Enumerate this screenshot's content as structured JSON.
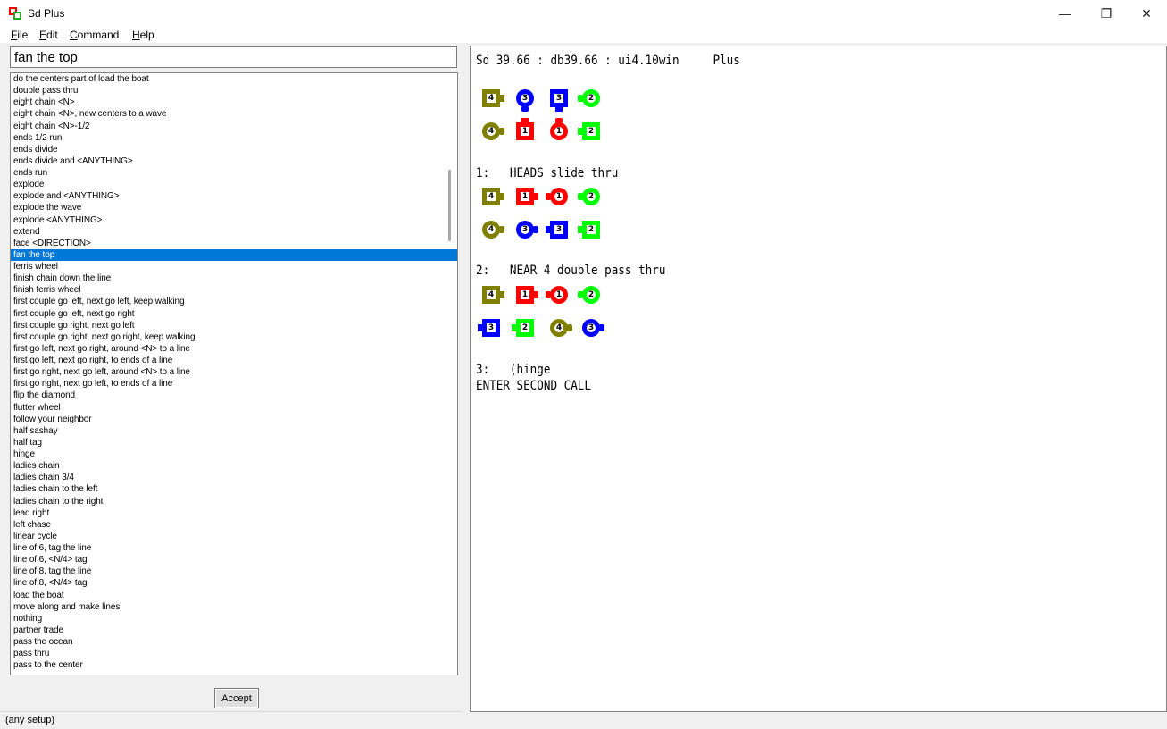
{
  "window": {
    "title": "Sd Plus",
    "minimize": "—",
    "maximize": "❐",
    "close": "✕"
  },
  "menu": [
    {
      "u": "F",
      "rest": "ile"
    },
    {
      "u": "E",
      "rest": "dit"
    },
    {
      "u": "C",
      "rest": "ommand"
    },
    {
      "u": "H",
      "rest": "elp"
    }
  ],
  "command_input": {
    "value": "fan the top"
  },
  "calls": [
    "do the centers part of load the boat",
    "double pass thru",
    "eight chain <N>",
    "eight chain <N>, new centers to a wave",
    "eight chain <N>-1/2",
    "ends 1/2 run",
    "ends divide",
    "ends divide and <ANYTHING>",
    "ends run",
    "explode",
    "explode and <ANYTHING>",
    "explode the wave",
    "explode <ANYTHING>",
    "extend",
    "face <DIRECTION>",
    "fan the top",
    "ferris wheel",
    "finish chain down the line",
    "finish ferris wheel",
    "first couple go left, next go left, keep walking",
    "first couple go left, next go right",
    "first couple go right, next go left",
    "first couple go right, next go right, keep walking",
    "first go left, next go right, around <N> to a line",
    "first go left, next go right, to ends of a line",
    "first go right, next go left, around <N> to a line",
    "first go right, next go left, to ends of a line",
    "flip the diamond",
    "flutter wheel",
    "follow your neighbor",
    "half sashay",
    "half tag",
    "hinge",
    "ladies chain",
    "ladies chain 3/4",
    "ladies chain to the left",
    "ladies chain to the right",
    "lead right",
    "left chase",
    "linear cycle",
    "line of 6, tag the line",
    "line of 6, <N/4> tag",
    "line of 8, tag the line",
    "line of 8, <N/4> tag",
    "load the boat",
    "move along and make lines",
    "nothing",
    "partner trade",
    "pass the ocean",
    "pass thru",
    "pass to the center"
  ],
  "selected_call": "fan the top",
  "accept_label": "Accept",
  "status_text": "(any setup)",
  "colors": {
    "c1": "#ff0000",
    "c2": "#00ff00",
    "c3": "#0000ff",
    "c4": "#808000",
    "select": "#0078d7"
  },
  "output": {
    "header": "Sd 39.66 : db39.66 : ui4.10win     Plus",
    "call1": "1:   HEADS slide thru",
    "call2": "2:   NEAR 4 double pass thru",
    "call3": "3:   (hinge",
    "prompt": "ENTER SECOND CALL"
  },
  "formations": [
    [
      [
        {
          "n": "4",
          "s": "sq",
          "d": "right"
        },
        {
          "n": "3",
          "s": "ci",
          "d": "down"
        },
        {
          "n": "3",
          "s": "sq",
          "d": "down"
        },
        {
          "n": "2",
          "s": "ci",
          "d": "left"
        }
      ],
      [
        {
          "n": "4",
          "s": "ci",
          "d": "right"
        },
        {
          "n": "1",
          "s": "sq",
          "d": "up"
        },
        {
          "n": "1",
          "s": "ci",
          "d": "up"
        },
        {
          "n": "2",
          "s": "sq",
          "d": "left"
        }
      ]
    ],
    [
      [
        {
          "n": "4",
          "s": "sq",
          "d": "right"
        },
        {
          "n": "1",
          "s": "sq",
          "d": "right"
        },
        {
          "n": "1",
          "s": "ci",
          "d": "left"
        },
        {
          "n": "2",
          "s": "ci",
          "d": "left"
        }
      ],
      [
        {
          "n": "4",
          "s": "ci",
          "d": "right"
        },
        {
          "n": "3",
          "s": "ci",
          "d": "right"
        },
        {
          "n": "3",
          "s": "sq",
          "d": "left"
        },
        {
          "n": "2",
          "s": "sq",
          "d": "left"
        }
      ]
    ],
    [
      [
        {
          "n": "4",
          "s": "sq",
          "d": "right"
        },
        {
          "n": "1",
          "s": "sq",
          "d": "right"
        },
        {
          "n": "1",
          "s": "ci",
          "d": "left"
        },
        {
          "n": "2",
          "s": "ci",
          "d": "left"
        }
      ],
      [
        {
          "n": "3",
          "s": "sq",
          "d": "left"
        },
        {
          "n": "2",
          "s": "sq",
          "d": "left"
        },
        {
          "n": "4",
          "s": "ci",
          "d": "right"
        },
        {
          "n": "3",
          "s": "ci",
          "d": "right"
        }
      ]
    ]
  ]
}
